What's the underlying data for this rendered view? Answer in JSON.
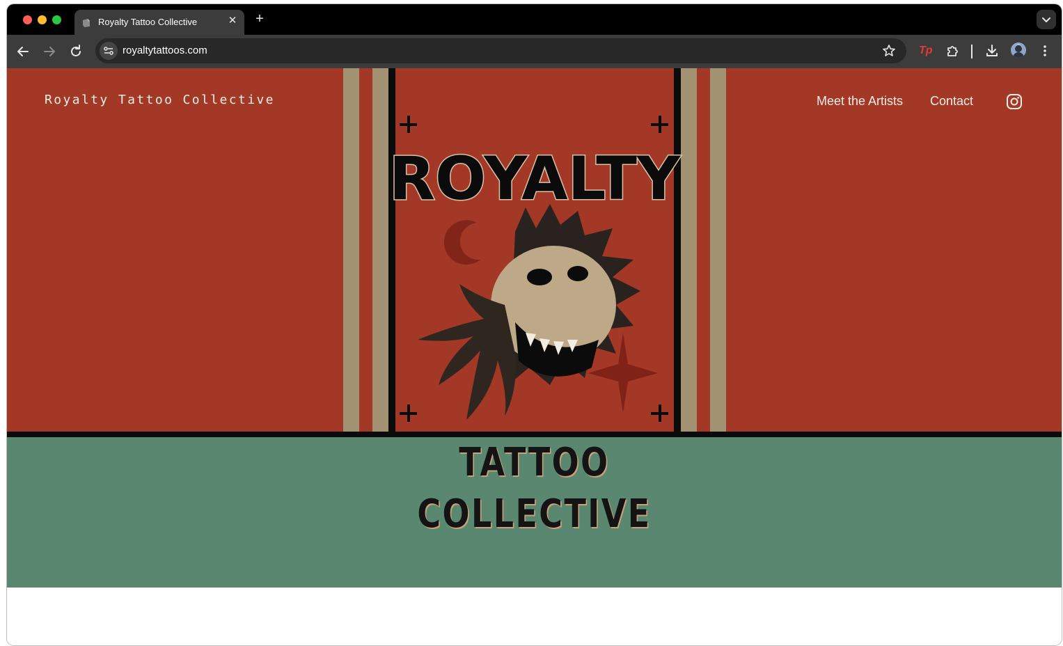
{
  "browser": {
    "tab_title": "Royalty Tattoo Collective",
    "url": "royaltytattoos.com",
    "extension_badge": "Tp",
    "icons": [
      "back-arrow-icon",
      "forward-arrow-icon",
      "reload-icon",
      "site-settings-icon",
      "star-icon",
      "extensions-icon",
      "download-icon",
      "kebab-menu-icon",
      "chevron-down-icon",
      "close-icon",
      "plus-icon"
    ]
  },
  "site": {
    "brand": "Royalty Tattoo Collective",
    "nav": [
      {
        "label": "Meet the Artists"
      },
      {
        "label": "Contact"
      }
    ],
    "instagram_icon": "instagram-icon",
    "logo_text": "ROYALTY",
    "wordmark_line1": "TATTOO",
    "wordmark_line2": "COLLECTIVE",
    "colors": {
      "hero_red": "#a33826",
      "hero_green": "#5a8770",
      "stripe_tan": "#a39272",
      "ink": "#141414"
    }
  }
}
